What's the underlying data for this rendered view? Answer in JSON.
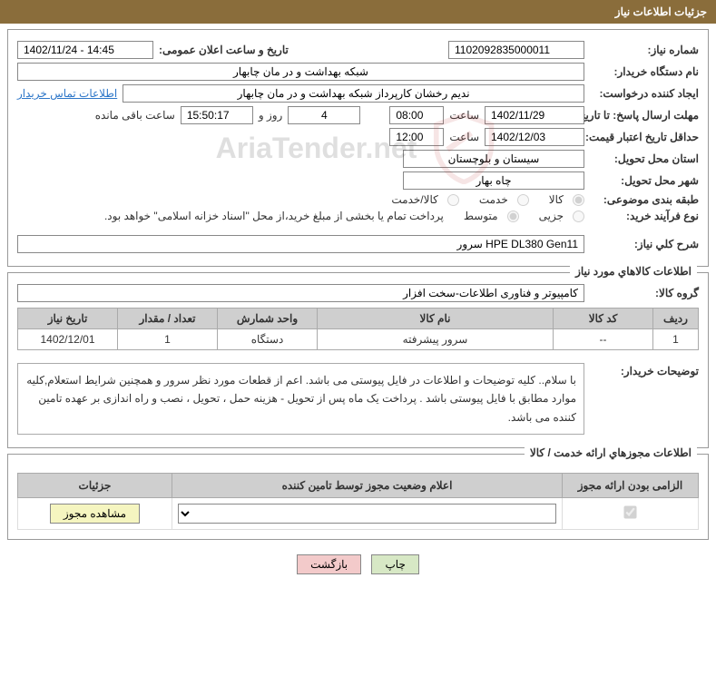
{
  "header": {
    "title": "جزئیات اطلاعات نیاز"
  },
  "sections": {
    "main": {
      "need_number_label": "شماره نیاز:",
      "need_number": "1102092835000011",
      "announce_label": "تاریخ و ساعت اعلان عمومی:",
      "announce_value": "1402/11/24 - 14:45",
      "buyer_org_label": "نام دستگاه خریدار:",
      "buyer_org": "شبکه بهداشت و در مان چابهار",
      "requestor_label": "ایجاد کننده درخواست:",
      "requestor": "ندیم رخشان کارپرداز شبکه بهداشت و در مان چابهار",
      "contact_link": "اطلاعات تماس خریدار",
      "deadline_label": "مهلت ارسال پاسخ: تا تاریخ:",
      "deadline_date": "1402/11/29",
      "time_word": "ساعت",
      "deadline_time": "08:00",
      "days_remain": "4",
      "days_word": "روز و",
      "time_remain": "15:50:17",
      "remain_word": "ساعت باقی مانده",
      "validity_label": "حداقل تاریخ اعتبار قیمت: تا تاریخ:",
      "validity_date": "1402/12/03",
      "validity_time": "12:00",
      "province_label": "استان محل تحویل:",
      "province": "سیستان و بلوچستان",
      "city_label": "شهر محل تحویل:",
      "city": "چاه بهار",
      "subject_cat_label": "طبقه بندی موضوعی:",
      "radio_kala": "کالا",
      "radio_khadamat": "خدمت",
      "radio_kala_khadamat": "کالا/خدمت",
      "process_type_label": "نوع فرآیند خرید:",
      "radio_jozee": "جزیی",
      "radio_motavaset": "متوسط",
      "process_note": "پرداخت تمام یا بخشی از مبلغ خرید،از محل \"اسناد خزانه اسلامی\" خواهد بود.",
      "summary_label": "شرح کلي نیاز:",
      "summary_value": "سرور HPE DL380 Gen11"
    },
    "goods": {
      "title": "اطلاعات کالاهاي مورد نیاز",
      "group_label": "گروه کالا:",
      "group_value": "کامپیوتر و فناوری اطلاعات-سخت افزار"
    },
    "licenses": {
      "title": "اطلاعات مجوزهاي ارائه خدمت / کالا"
    }
  },
  "table": {
    "headers": [
      "ردیف",
      "کد کالا",
      "نام کالا",
      "واحد شمارش",
      "تعداد / مقدار",
      "تاریخ نیاز"
    ],
    "rows": [
      {
        "idx": "1",
        "code": "--",
        "name": "سرور پیشرفته",
        "unit": "دستگاه",
        "qty": "1",
        "date": "1402/12/01"
      }
    ]
  },
  "buyer_notes": {
    "label": "توضیحات خریدار:",
    "text": "با سلام.. کلیه توضیحات و اطلاعات در فایل پیوستی می باشد. اعم از قطعات مورد نظر سرور و همچنین شرایط استعلام,کلیه موارد مطابق با فایل پیوستی باشد . پرداخت یک ماه پس از تحویل - هزینه حمل ، تحویل ، نصب و راه اندازی بر عهده تامین کننده می باشد."
  },
  "license_table": {
    "headers": [
      "الزامی بودن ارائه مجوز",
      "اعلام وضعیت مجوز توسط تامین کننده",
      "جزئیات"
    ],
    "row": {
      "required": true,
      "status_options": [
        ""
      ],
      "view_btn": "مشاهده مجوز"
    }
  },
  "footer": {
    "print": "چاپ",
    "back": "بازگشت"
  },
  "watermark": {
    "text": "AriaTender.net"
  }
}
